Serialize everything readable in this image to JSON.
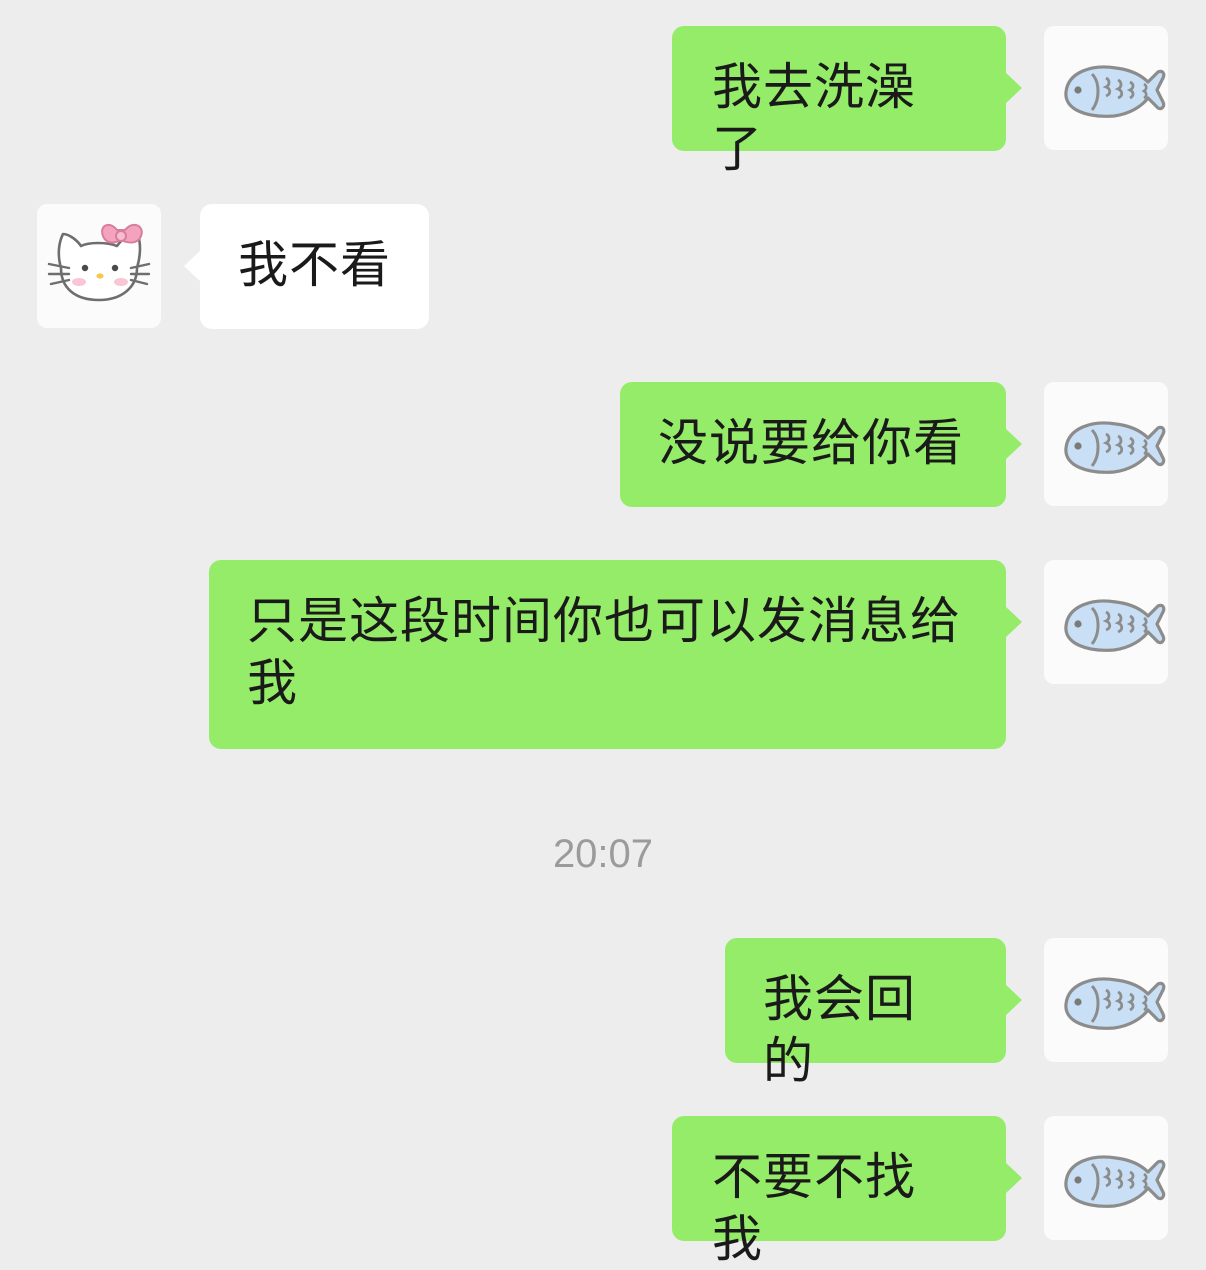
{
  "chat": {
    "messages": [
      {
        "sender": "me",
        "text": "我去洗澡了",
        "avatar_icon": "fish-icon"
      },
      {
        "sender": "other",
        "text": "我不看",
        "avatar_icon": "hello-kitty-icon"
      },
      {
        "sender": "me",
        "text": "没说要给你看",
        "avatar_icon": "fish-icon"
      },
      {
        "sender": "me",
        "text": "只是这段时间你也可以发消息给我",
        "avatar_icon": "fish-icon"
      },
      {
        "sender": "me",
        "text": "我会回的",
        "avatar_icon": "fish-icon"
      },
      {
        "sender": "me",
        "text": "不要不找我",
        "avatar_icon": "fish-icon"
      }
    ],
    "timestamp": "20:07"
  },
  "colors": {
    "background": "#ededed",
    "my_bubble": "#95ec69",
    "their_bubble": "#ffffff",
    "text": "#1a1a1a",
    "timestamp": "#9b9b9b",
    "fish_fill": "#c9dff5",
    "fish_outline": "#8c8c8c",
    "bow_pink": "#f4a3bf"
  }
}
